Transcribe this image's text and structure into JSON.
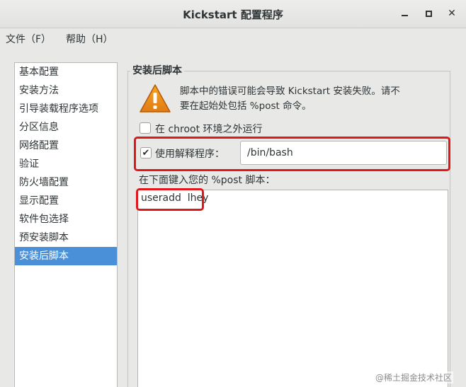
{
  "window": {
    "title": "Kickstart 配置程序"
  },
  "menubar": {
    "file": "文件（F）",
    "help": "帮助（H）"
  },
  "sidebar": {
    "items": [
      {
        "label": "基本配置"
      },
      {
        "label": "安装方法"
      },
      {
        "label": "引导装载程序选项"
      },
      {
        "label": "分区信息"
      },
      {
        "label": "网络配置"
      },
      {
        "label": "验证"
      },
      {
        "label": "防火墙配置"
      },
      {
        "label": "显示配置"
      },
      {
        "label": "软件包选择"
      },
      {
        "label": "预安装脚本"
      },
      {
        "label": "安装后脚本",
        "selected": true
      }
    ]
  },
  "post_script": {
    "section_title": "安装后脚本",
    "warning_line1": "脚本中的错误可能会导致 Kickstart 安装失败。请不",
    "warning_line2": "要在起始处包括 %post 命令。",
    "chroot_label": "在 chroot 环境之外运行",
    "chroot_checked": false,
    "interpreter_label": "使用解释程序：",
    "interpreter_checked": true,
    "interpreter_value": "/bin/bash",
    "script_label": "在下面键入您的 %post 脚本：",
    "script_text": "useradd  lhey"
  },
  "icons": {
    "warning": "warning-triangle-icon",
    "checkmark": "checkmark-icon",
    "minimize": "minimize-icon",
    "maximize": "maximize-icon",
    "close": "close-icon"
  },
  "colors": {
    "selection": "#4a90d9",
    "highlight": "#e0171b",
    "warning": "#e07b16"
  },
  "watermark": "@稀土掘金技术社区"
}
